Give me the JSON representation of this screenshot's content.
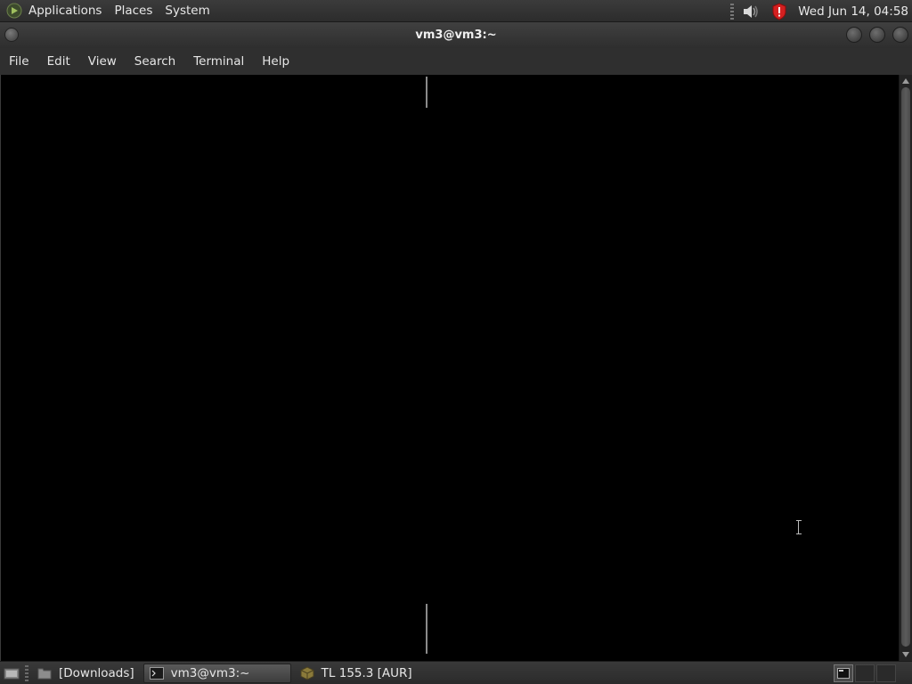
{
  "top_panel": {
    "menus": [
      "Applications",
      "Places",
      "System"
    ],
    "clock": "Wed Jun 14, 04:58",
    "icons": [
      "mate-menu-icon",
      "volume-icon",
      "security-shield-icon"
    ]
  },
  "window": {
    "title": "vm3@vm3:~",
    "menubar": [
      "File",
      "Edit",
      "View",
      "Search",
      "Terminal",
      "Help"
    ]
  },
  "taskbar": {
    "tasks": [
      {
        "label": "[Downloads]",
        "icon": "folder-icon",
        "active": false
      },
      {
        "label": "vm3@vm3:~",
        "icon": "terminal-icon",
        "active": true
      },
      {
        "label": "TL 155.3 [AUR]",
        "icon": "package-icon",
        "active": false
      }
    ]
  },
  "colors": {
    "panel_bg": "#333333",
    "terminal_bg": "#000000",
    "text": "#e6e6e6",
    "shield_red": "#d42020"
  }
}
